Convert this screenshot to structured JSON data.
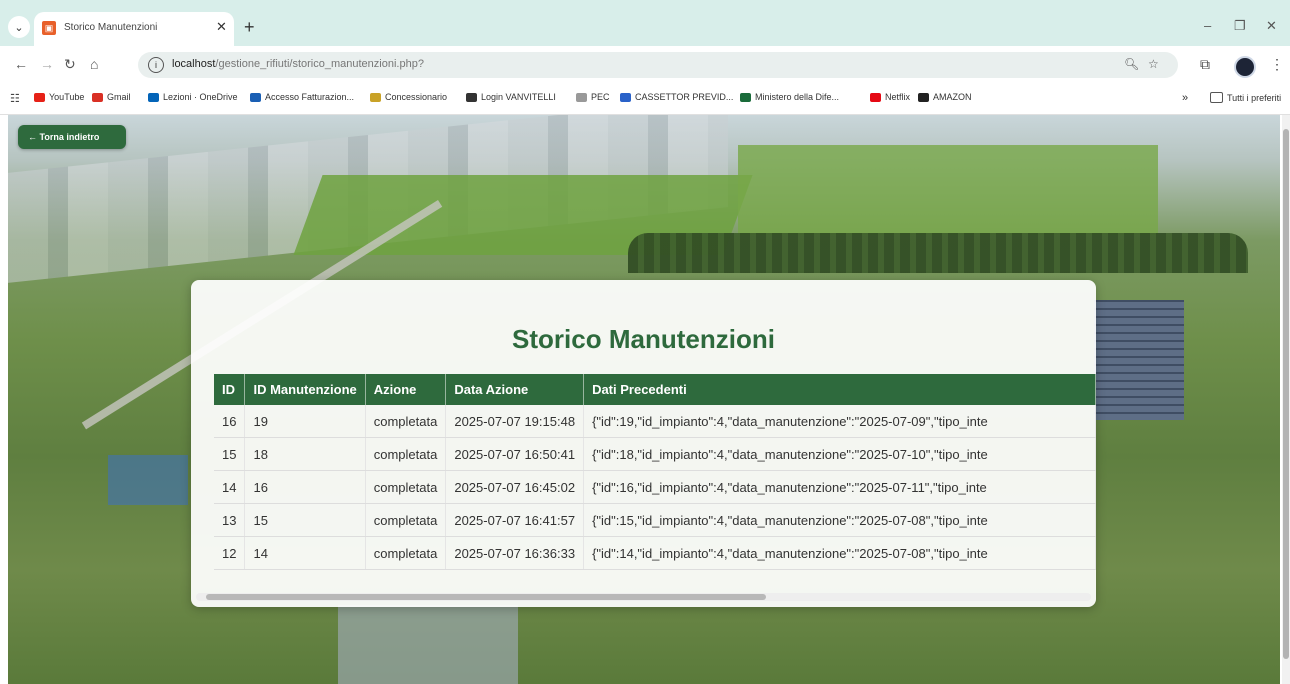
{
  "browser": {
    "tab_title": "Storico Manutenzioni",
    "url_host": "localhost",
    "url_path": "/gestione_rifiuti/storico_manutenzioni.php?",
    "bookmarks": [
      {
        "label": "YouTube",
        "color": "#e62117"
      },
      {
        "label": "Gmail",
        "color": "#d93025"
      },
      {
        "label": "Lezioni · OneDrive",
        "color": "#0364b8"
      },
      {
        "label": "Accesso Fatturazion...",
        "color": "#1a5fb4"
      },
      {
        "label": "Concessionario",
        "color": "#c9a227"
      },
      {
        "label": "Login VANVITELLI",
        "color": "#333333"
      },
      {
        "label": "PEC",
        "color": "#999999"
      },
      {
        "label": "CASSETTOR PREVID...",
        "color": "#2a62c9"
      },
      {
        "label": "Ministero della Dife...",
        "color": "#1a6b3a"
      },
      {
        "label": "Netflix",
        "color": "#e50914"
      },
      {
        "label": "AMAZON",
        "color": "#222222"
      }
    ],
    "all_bookmarks": "Tutti i preferiti"
  },
  "page": {
    "back_label": "← Torna indietro",
    "title": "Storico Manutenzioni",
    "columns": [
      "ID",
      "ID Manutenzione",
      "Azione",
      "Data Azione",
      "Dati Precedenti"
    ],
    "rows": [
      {
        "id": "16",
        "id_man": "19",
        "azione": "completata",
        "data": "2025-07-07 19:15:48",
        "dati": "{\"id\":19,\"id_impianto\":4,\"data_manutenzione\":\"2025-07-09\",\"tipo_inte"
      },
      {
        "id": "15",
        "id_man": "18",
        "azione": "completata",
        "data": "2025-07-07 16:50:41",
        "dati": "{\"id\":18,\"id_impianto\":4,\"data_manutenzione\":\"2025-07-10\",\"tipo_inte"
      },
      {
        "id": "14",
        "id_man": "16",
        "azione": "completata",
        "data": "2025-07-07 16:45:02",
        "dati": "{\"id\":16,\"id_impianto\":4,\"data_manutenzione\":\"2025-07-11\",\"tipo_inte"
      },
      {
        "id": "13",
        "id_man": "15",
        "azione": "completata",
        "data": "2025-07-07 16:41:57",
        "dati": "{\"id\":15,\"id_impianto\":4,\"data_manutenzione\":\"2025-07-08\",\"tipo_inte"
      },
      {
        "id": "12",
        "id_man": "14",
        "azione": "completata",
        "data": "2025-07-07 16:36:33",
        "dati": "{\"id\":14,\"id_impianto\":4,\"data_manutenzione\":\"2025-07-08\",\"tipo_inte"
      }
    ]
  },
  "colors": {
    "accent": "#2e6a3d"
  }
}
